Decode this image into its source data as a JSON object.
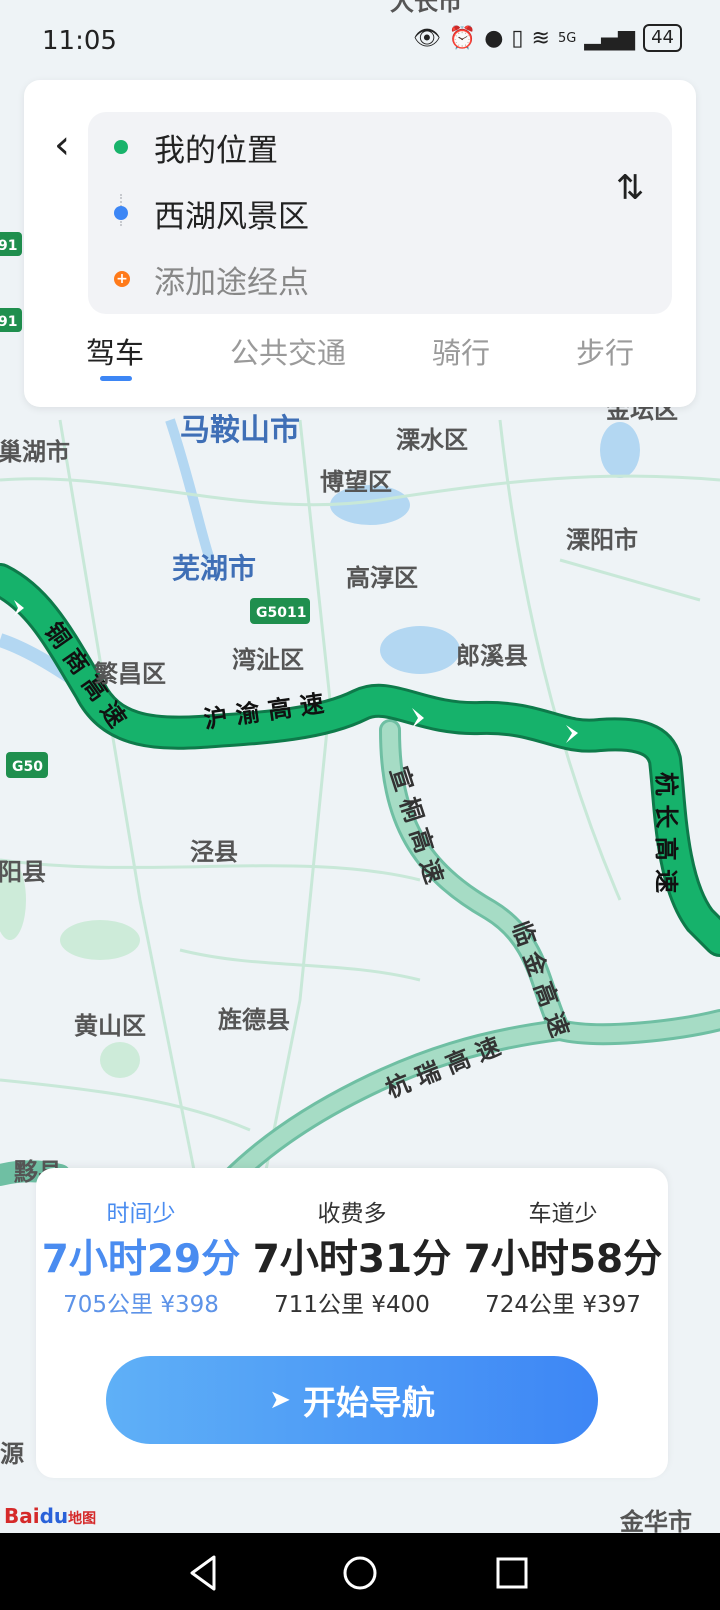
{
  "status_bar": {
    "time": "11:05",
    "network": "5G",
    "battery": "44"
  },
  "route": {
    "origin": "我的位置",
    "destination": "西湖风景区",
    "waypoint_placeholder": "添加途经点",
    "origin_color": "#19b36b",
    "destination_color": "#3d86f5"
  },
  "tabs": [
    {
      "label": "驾车",
      "active": true
    },
    {
      "label": "公共交通",
      "active": false
    },
    {
      "label": "骑行",
      "active": false
    },
    {
      "label": "步行",
      "active": false
    }
  ],
  "map": {
    "cities": [
      "马鞍山市",
      "芜湖市",
      "溧水区",
      "博望区",
      "溧阳市",
      "高淳区",
      "湾沚区",
      "繁昌区",
      "郎溪县",
      "泾县",
      "黄山区",
      "旌德县",
      "黟县",
      "巢湖市",
      "阳县",
      "大长市",
      "金坛区",
      "金华市",
      "源"
    ],
    "roads": [
      "铜商高速",
      "沪渝高速",
      "宣桐高速",
      "临金高速",
      "杭瑞高速",
      "杭长高速"
    ],
    "shields": [
      "G5011",
      "G50",
      "91",
      "91"
    ],
    "route_color": "#16b26b"
  },
  "options": [
    {
      "label": "时间少",
      "duration": "7小时29分",
      "distance": "705公里",
      "toll": "¥398",
      "selected": true
    },
    {
      "label": "收费多",
      "duration": "7小时31分",
      "distance": "711公里",
      "toll": "¥400",
      "selected": false
    },
    {
      "label": "车道少",
      "duration": "7小时58分",
      "distance": "724公里",
      "toll": "¥397",
      "selected": false
    }
  ],
  "start_button": {
    "label": "开始导航"
  },
  "logo": {
    "brand_a": "Bai",
    "brand_b": "du",
    "brand_c": "地图"
  }
}
